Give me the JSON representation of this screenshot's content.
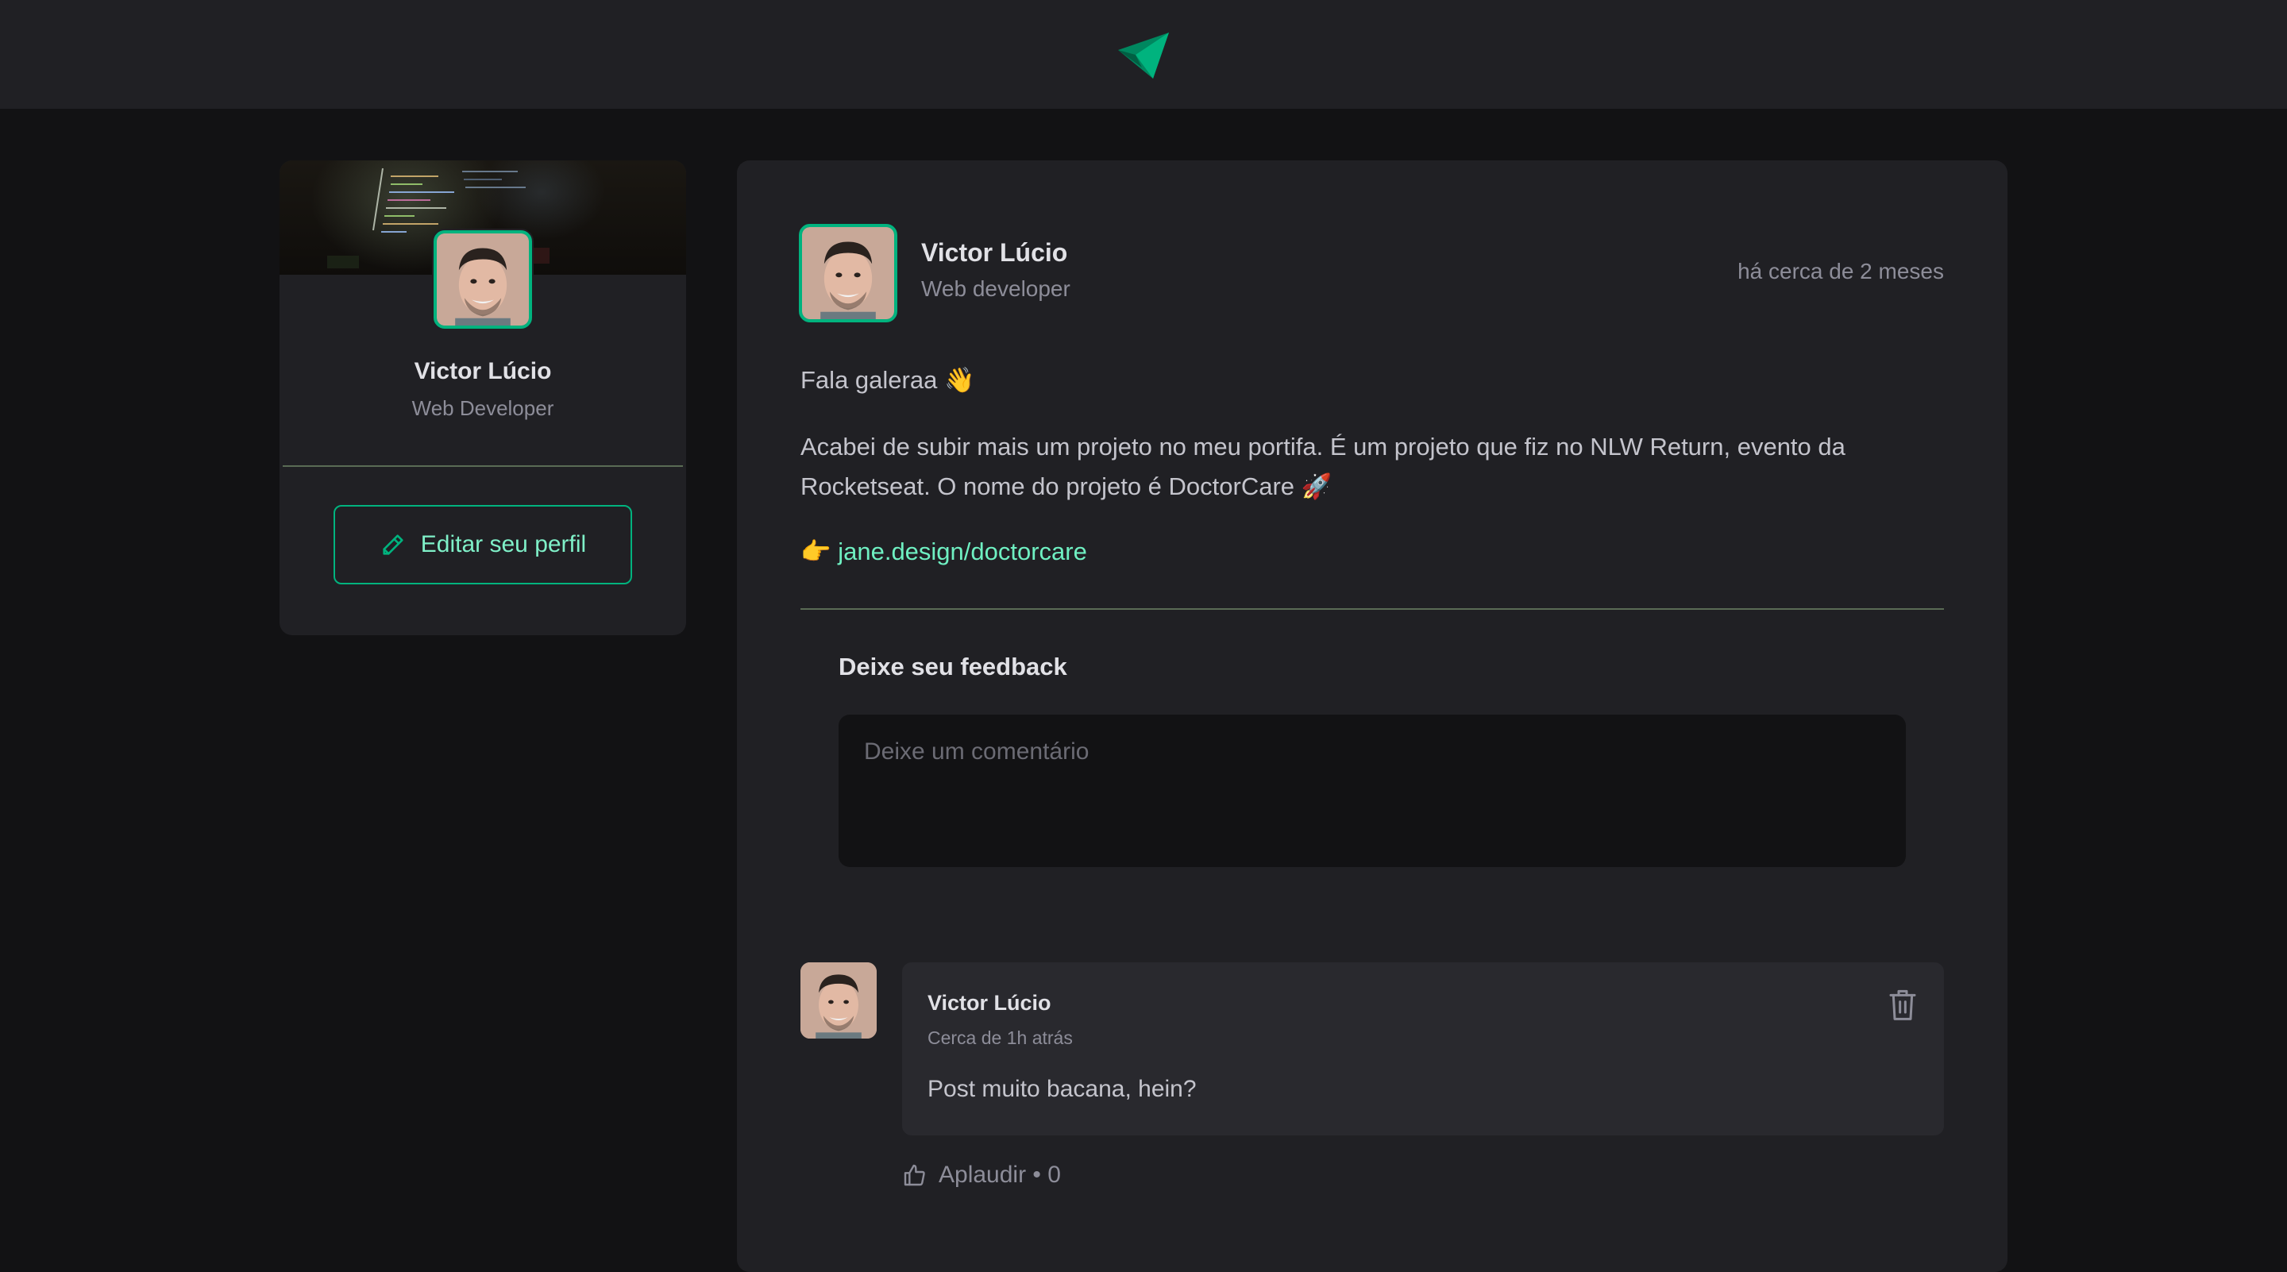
{
  "header": {
    "logo_icon": "paper-plane-logo-icon"
  },
  "sidebar": {
    "cover_icon": "code-cover-image",
    "name": "Victor Lúcio",
    "role": "Web Developer",
    "edit_button": {
      "label": "Editar seu perfil",
      "icon": "pencil-icon"
    }
  },
  "post": {
    "author": {
      "name": "Victor Lúcio",
      "role": "Web developer"
    },
    "time": "há cerca de 2 meses",
    "content": {
      "greeting": "Fala galeraa 👋",
      "paragraph": "Acabei de subir mais um projeto no meu portifa. É um projeto que fiz no NLW Return, evento da Rocketseat. O nome do projeto é DoctorCare 🚀",
      "link_prefix": "👉 ",
      "link_text": "jane.design/doctorcare"
    },
    "feedback": {
      "title": "Deixe seu feedback",
      "placeholder": "Deixe um comentário"
    }
  },
  "comments": [
    {
      "author": "Victor Lúcio",
      "time": "Cerca de 1h atrás",
      "text": "Post muito bacana, hein?",
      "delete_icon": "trash-icon",
      "applaud_label": "Aplaudir",
      "applaud_separator": " • ",
      "applaud_count": "0",
      "applaud_icon": "thumbs-up-icon"
    }
  ],
  "colors": {
    "background": "#121214",
    "surface": "#202024",
    "accent": "#00b37e",
    "text": "#e1e1e6",
    "muted": "#8d8d99"
  }
}
